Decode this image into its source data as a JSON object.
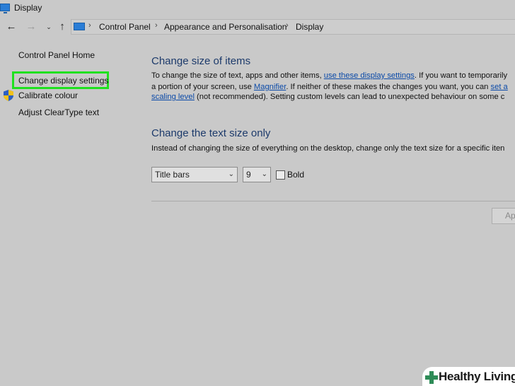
{
  "window": {
    "title": "Display"
  },
  "address_bar": {
    "breadcrumbs": [
      "Control Panel",
      "Appearance and Personalisation",
      "Display"
    ]
  },
  "left_nav": {
    "home": "Control Panel Home",
    "items": [
      "Change display settings",
      "Calibrate colour",
      "Adjust ClearType text"
    ]
  },
  "main": {
    "section1": {
      "heading": "Change size of items",
      "line1_a": "To change the size of text, apps and other items, ",
      "line1_link": "use these display settings",
      "line1_b": ". If you want to temporarily",
      "line2_a": "a portion of your screen, use ",
      "line2_link1": "Magnifier",
      "line2_b": ". If neither of these makes the changes you want, you can ",
      "line2_link2": "set a",
      "line3_link": "scaling level",
      "line3_b": " (not recommended). Setting custom levels can lead to unexpected behaviour on some c"
    },
    "section2": {
      "heading": "Change the text size only",
      "text": "Instead of changing the size of everything on the desktop, change only the text size for a specific iten",
      "element_select": "Title bars",
      "size_select": "9",
      "bold_label": "Bold",
      "bold_checked": false
    },
    "apply_label": "Ap"
  },
  "watermark": {
    "text": "Healthy Living"
  }
}
